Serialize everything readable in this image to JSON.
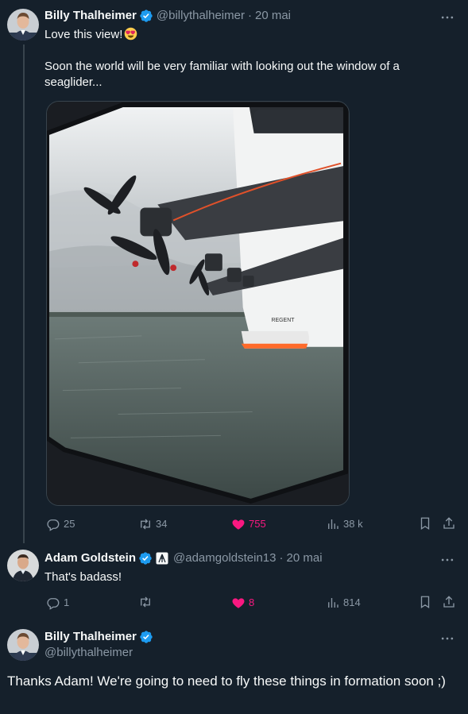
{
  "tweet1": {
    "author_name": "Billy Thalheimer",
    "handle": "@billythalheimer",
    "separator": "·",
    "date": "20 mai",
    "line1": "Love this view!",
    "line2": "Soon the world will be very familiar with looking out the window of a seaglider...",
    "replies": "25",
    "retweets": "34",
    "likes": "755",
    "views": "38 k",
    "media_text": "REGENT"
  },
  "reply": {
    "author_name": "Adam Goldstein",
    "handle": "@adamgoldstein13",
    "separator": "·",
    "date": "20 mai",
    "text": "That's badass!",
    "replies": "1",
    "retweets": "",
    "likes": "8",
    "views": "814"
  },
  "main": {
    "author_name": "Billy Thalheimer",
    "handle": "@billythalheimer",
    "text": "Thanks Adam!  We're going to need to fly these things in formation soon ;)"
  },
  "icons": {
    "verified": "verified-badge-icon",
    "affiliate": "affiliate-logo-icon",
    "more": "more-horizontal-icon",
    "reply": "reply-icon",
    "retweet": "retweet-icon",
    "like": "heart-icon",
    "views": "views-icon",
    "bookmark": "bookmark-icon",
    "share": "share-icon",
    "emoji": "heart-eyes-emoji-icon"
  },
  "colors": {
    "background": "#15202b",
    "text": "#f7f9f9",
    "secondary": "#8b98a5",
    "verified": "#1d9bf0",
    "like": "#f91880",
    "border": "#38444d"
  }
}
